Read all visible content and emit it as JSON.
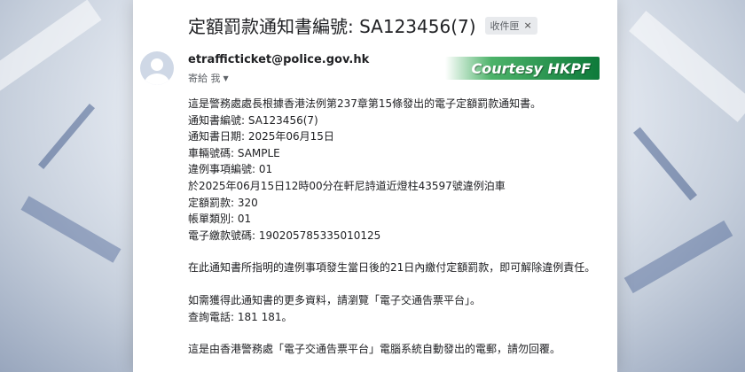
{
  "email": {
    "subject": "定額罰款通知書編號: SA123456(7)",
    "label_badge": "收件匣",
    "sender": "etrafficticket@police.gov.hk",
    "recipient_line": "寄給 我"
  },
  "watermark": "Courtesy HKPF",
  "body": {
    "block1": [
      "這是警務處處長根據香港法例第237章第15條發出的電子定額罰款通知書。",
      "通知書編號: SA123456(7)",
      "通知書日期: 2025年06月15日",
      "車輛號碼: SAMPLE",
      "違例事項編號: 01",
      "於2025年06月15日12時00分在軒尼詩道近燈柱43597號違例泊車",
      "定額罰款: 320",
      "帳單類別: 01",
      "電子繳款號碼: 190205785335010125"
    ],
    "block2": "在此通知書所指明的違例事項發生當日後的21日內繳付定額罰款，即可解除違例責任。",
    "block3": [
      "如需獲得此通知書的更多資料，請瀏覽「電子交通告票平台」。",
      "查詢電話: 181 181。"
    ],
    "block4": "這是由香港警務處「電子交通告票平台」電腦系統自動發出的電郵，請勿回覆。"
  }
}
